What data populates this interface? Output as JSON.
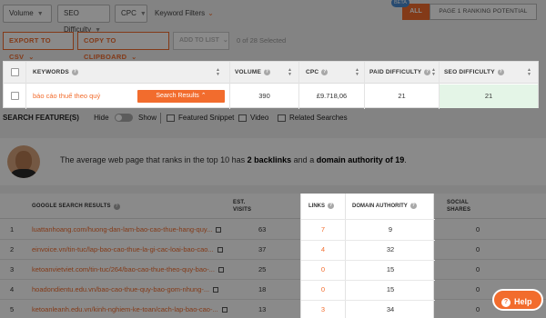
{
  "filters": {
    "volume": "Volume",
    "seo_difficulty": "SEO Difficulty",
    "cpc": "CPC",
    "keyword_filters": "Keyword Filters",
    "beta": "BETA",
    "all": "ALL",
    "page1": "PAGE 1 RANKING POTENTIAL"
  },
  "actions": {
    "export_csv": "EXPORT TO CSV",
    "copy_clipboard": "COPY TO CLIPBOARD",
    "add_to_list": "ADD TO LIST",
    "selected": "0 of 28 Selected"
  },
  "keyword_table": {
    "headers": {
      "keywords": "KEYWORDS",
      "volume": "VOLUME",
      "cpc": "CPC",
      "paid_difficulty": "PAID DIFFICULTY",
      "seo_difficulty": "SEO DIFFICULTY"
    },
    "row": {
      "keyword": "báo cáo thuế theo quý",
      "button": "Search Results",
      "volume": "390",
      "cpc": "£9.718,06",
      "paid_difficulty": "21",
      "seo_difficulty": "21"
    }
  },
  "search_features": {
    "title": "SEARCH FEATURE(S)",
    "hide": "Hide",
    "show": "Show",
    "featured_snippet": "Featured Snippet",
    "video": "Video",
    "related_searches": "Related Searches"
  },
  "banner": {
    "text_1": "The average web page that ranks in the top 10 has ",
    "bold_1": "2 backlinks",
    "text_2": " and a ",
    "bold_2": "domain authority of 19",
    "text_3": "."
  },
  "serp": {
    "headers": {
      "results": "GOOGLE SEARCH RESULTS",
      "est_visits_1": "EST.",
      "est_visits_2": "VISITS",
      "links": "LINKS",
      "domain_authority": "DOMAIN AUTHORITY",
      "social_1": "SOCIAL",
      "social_2": "SHARES"
    },
    "rows": [
      {
        "n": "1",
        "url": "luattanhoang.com/huong-dan-lam-bao-cao-thue-hang-quy...",
        "visits": "63",
        "links": "7",
        "da": "9",
        "social": "0"
      },
      {
        "n": "2",
        "url": "einvoice.vn/tin-tuc/lap-bao-cao-thue-la-gi-cac-loai-bao-cao...",
        "visits": "37",
        "links": "4",
        "da": "32",
        "social": "0"
      },
      {
        "n": "3",
        "url": "ketoanvietviet.com/tin-tuc/264/bao-cao-thue-theo-quy-bao-...",
        "visits": "25",
        "links": "0",
        "da": "15",
        "social": "0"
      },
      {
        "n": "4",
        "url": "hoadondientu.edu.vn/bao-cao-thue-quy-bao-gom-nhung-...",
        "visits": "18",
        "links": "0",
        "da": "15",
        "social": "0"
      },
      {
        "n": "5",
        "url": "ketoanleanh.edu.vn/kinh-nghiem-ke-toan/cach-lap-bao-cao-...",
        "visits": "13",
        "links": "3",
        "da": "34",
        "social": "0"
      }
    ]
  },
  "help": "Help"
}
